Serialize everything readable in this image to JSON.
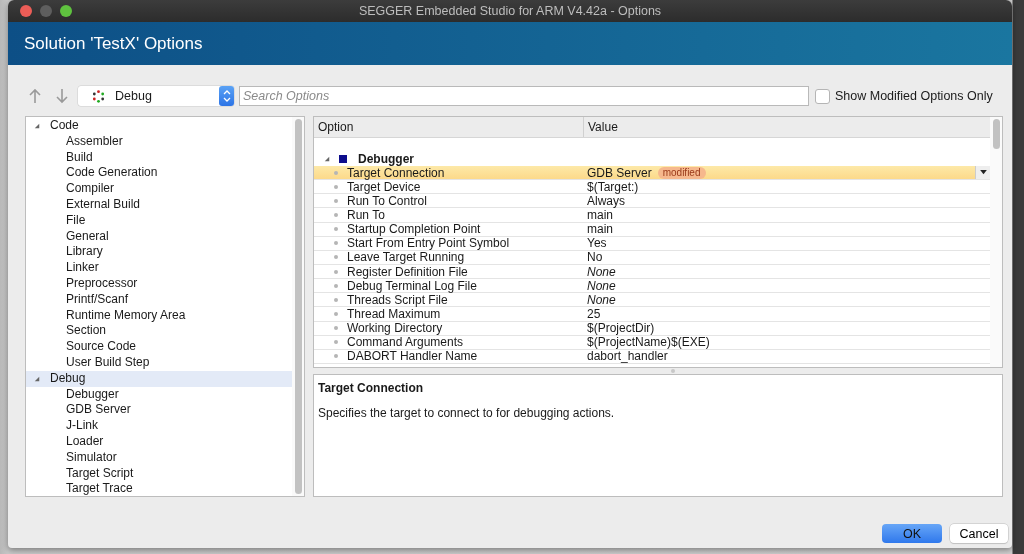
{
  "window": {
    "title": "SEGGER Embedded Studio for ARM V4.42a - Options"
  },
  "dialog": {
    "title": "Solution 'TestX' Options"
  },
  "toolbar": {
    "configuration": "Debug",
    "search": {
      "placeholder": "Search Options"
    },
    "show_modified_only": {
      "label": "Show Modified Options Only",
      "checked": false
    }
  },
  "tree": [
    {
      "label": "Code",
      "expanded": true,
      "selected": false,
      "children": [
        {
          "label": "Assembler",
          "selected": false
        },
        {
          "label": "Build",
          "selected": false
        },
        {
          "label": "Code Generation",
          "selected": false
        },
        {
          "label": "Compiler",
          "selected": false
        },
        {
          "label": "External Build",
          "selected": false
        },
        {
          "label": "File",
          "selected": false
        },
        {
          "label": "General",
          "selected": false
        },
        {
          "label": "Library",
          "selected": false
        },
        {
          "label": "Linker",
          "selected": false
        },
        {
          "label": "Preprocessor",
          "selected": false
        },
        {
          "label": "Printf/Scanf",
          "selected": false
        },
        {
          "label": "Runtime Memory Area",
          "selected": false
        },
        {
          "label": "Section",
          "selected": false
        },
        {
          "label": "Source Code",
          "selected": false
        },
        {
          "label": "User Build Step",
          "selected": false
        }
      ]
    },
    {
      "label": "Debug",
      "expanded": true,
      "selected": true,
      "children": [
        {
          "label": "Debugger",
          "selected": false
        },
        {
          "label": "GDB Server",
          "selected": false
        },
        {
          "label": "J-Link",
          "selected": false
        },
        {
          "label": "Loader",
          "selected": false
        },
        {
          "label": "Simulator",
          "selected": false
        },
        {
          "label": "Target Script",
          "selected": false
        },
        {
          "label": "Target Trace",
          "selected": false
        }
      ]
    }
  ],
  "options_table": {
    "columns": [
      "Option",
      "Value"
    ],
    "group": {
      "label": "Debugger",
      "expanded": true
    },
    "rows": [
      {
        "option": "Target Connection",
        "value": "GDB Server",
        "badge": "modified",
        "italic": false,
        "selected": true
      },
      {
        "option": "Target Device",
        "value": "$(Target:)",
        "italic": false,
        "selected": false
      },
      {
        "option": "Run To Control",
        "value": "Always",
        "italic": false,
        "selected": false
      },
      {
        "option": "Run To",
        "value": "main",
        "italic": false,
        "selected": false
      },
      {
        "option": "Startup Completion Point",
        "value": "main",
        "italic": false,
        "selected": false
      },
      {
        "option": "Start From Entry Point Symbol",
        "value": "Yes",
        "italic": false,
        "selected": false
      },
      {
        "option": "Leave Target Running",
        "value": "No",
        "italic": false,
        "selected": false
      },
      {
        "option": "Register Definition File",
        "value": "None",
        "italic": true,
        "selected": false
      },
      {
        "option": "Debug Terminal Log File",
        "value": "None",
        "italic": true,
        "selected": false
      },
      {
        "option": "Threads Script File",
        "value": "None",
        "italic": true,
        "selected": false
      },
      {
        "option": "Thread Maximum",
        "value": "25",
        "italic": false,
        "selected": false
      },
      {
        "option": "Working Directory",
        "value": "$(ProjectDir)",
        "italic": false,
        "selected": false
      },
      {
        "option": "Command Arguments",
        "value": "$(ProjectName)$(EXE)",
        "italic": false,
        "selected": false
      },
      {
        "option": "DABORT Handler Name",
        "value": "dabort_handler",
        "italic": false,
        "selected": false
      }
    ]
  },
  "description": {
    "title": "Target Connection",
    "text": "Specifies the target to connect to for debugging actions."
  },
  "buttons": [
    {
      "label": "OK",
      "kind": "primary"
    },
    {
      "label": "Cancel",
      "kind": "secondary"
    }
  ]
}
